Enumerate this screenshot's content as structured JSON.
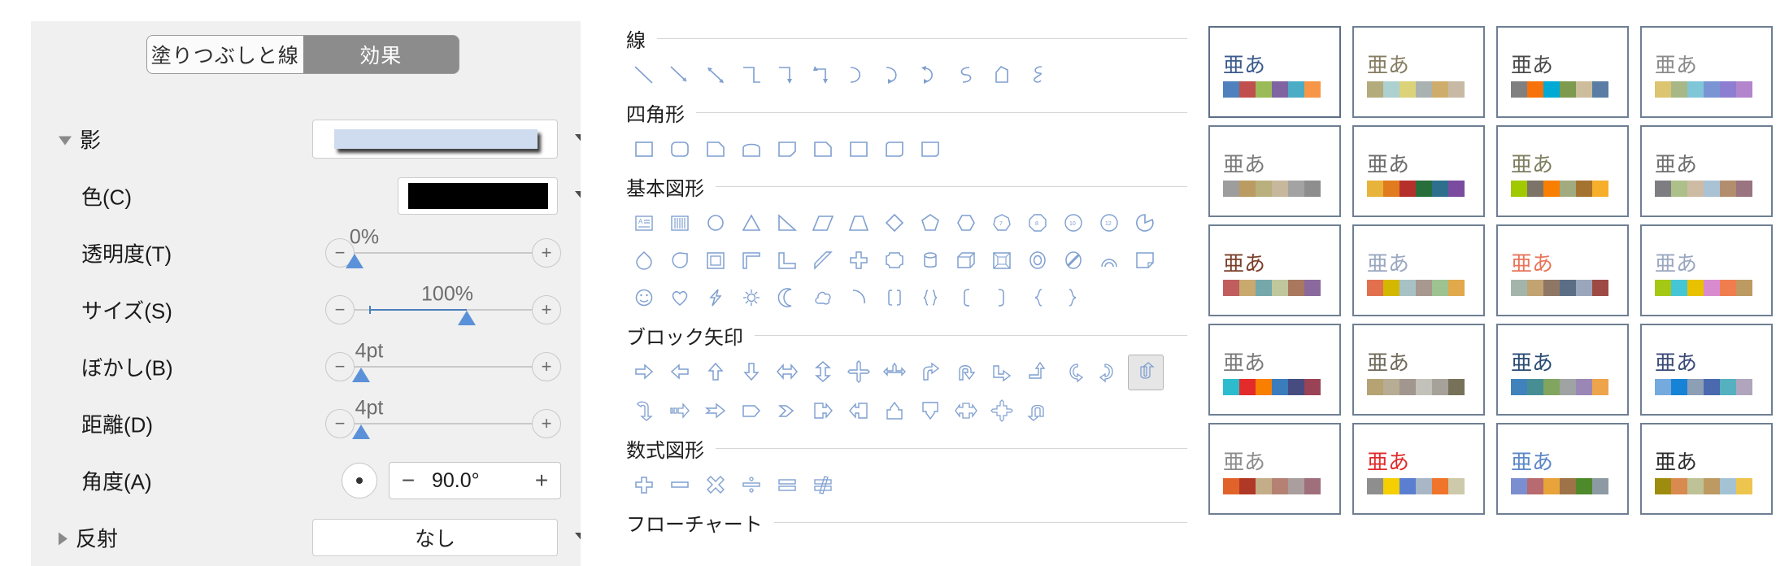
{
  "format_panel": {
    "tabs": [
      {
        "label": "塗りつぶしと線",
        "active": false
      },
      {
        "label": "効果",
        "active": true
      }
    ],
    "sections": [
      {
        "name": "shadow",
        "label": "影",
        "expanded": true,
        "disclosure": "triangle-down"
      },
      {
        "name": "reflection",
        "label": "反射",
        "expanded": false,
        "disclosure": "triangle-right"
      }
    ],
    "shadow_preset": {
      "label": "",
      "dropdown_arrow": "chevron-down-icon"
    },
    "rows": [
      {
        "id": "color",
        "label": "色(C)",
        "type": "color",
        "value": "#000000"
      },
      {
        "id": "transparency",
        "label": "透明度(T)",
        "type": "slider",
        "value": "0%",
        "percent": 0
      },
      {
        "id": "size",
        "label": "サイズ(S)",
        "type": "slider",
        "value": "100%",
        "percent": 45
      },
      {
        "id": "blur",
        "label": "ぼかし(B)",
        "type": "slider",
        "value": "4pt",
        "percent": 8
      },
      {
        "id": "distance",
        "label": "距離(D)",
        "type": "slider",
        "value": "4pt",
        "percent": 8
      },
      {
        "id": "angle",
        "label": "角度(A)",
        "type": "spinner",
        "value": "90.0°",
        "minus": "−",
        "plus": "+"
      }
    ],
    "reflection_value": "なし",
    "minus_label": "−",
    "plus_label": "+"
  },
  "shapes_panel": {
    "groups": [
      {
        "title": "線",
        "shapes": [
          "line",
          "line-arrow",
          "line-double-arrow",
          "elbow-connector",
          "elbow-arrow-connector",
          "elbow-double-arrow-connector",
          "curved-connector",
          "curved-arrow-connector",
          "curved-double-arrow-connector",
          "curve",
          "freeform",
          "scribble"
        ]
      },
      {
        "title": "四角形",
        "shapes": [
          "rectangle",
          "rounded-rectangle",
          "snip-single-corner-rectangle",
          "round-single-corner-top",
          "snip-diagonal-corner-rectangle",
          "snip-and-round-single-corner",
          "round-same-side-corner",
          "round-diagonal-corner",
          "snip-same-side-corner"
        ]
      },
      {
        "title": "基本図形",
        "shapes": [
          "text-box",
          "vertical-text-box",
          "oval",
          "isosceles-triangle",
          "right-triangle",
          "parallelogram",
          "trapezoid",
          "diamond",
          "pentagon",
          "hexagon",
          "heptagon",
          "octagon",
          "decagon",
          "dodecagon",
          "pie",
          "teardrop",
          "chord",
          "frame",
          "corner",
          "L-shape",
          "diagonal-stripe",
          "cross",
          "plaque",
          "can",
          "cube",
          "bevel",
          "donut",
          "no-symbol",
          "arc",
          "folded-corner",
          "smiley-face",
          "heart",
          "lightning-bolt",
          "sun",
          "moon",
          "cloud",
          "arc-open",
          "double-bracket",
          "double-brace",
          "left-bracket",
          "right-bracket",
          "left-brace",
          "right-brace"
        ]
      },
      {
        "title": "ブロック矢印",
        "shapes": [
          "right-arrow",
          "left-arrow",
          "up-arrow",
          "down-arrow",
          "left-right-arrow",
          "up-down-arrow",
          "quad-arrow",
          "left-right-up-arrow",
          "bent-arrow",
          "u-turn-arrow",
          "bent-up-arrow",
          "bent-up-arrow-2",
          "curved-left-arrow",
          "curved-right-arrow",
          "curved-up-arrow",
          "curved-down-arrow",
          "striped-right-arrow",
          "notched-right-arrow",
          "pentagon-arrow",
          "chevron-arrow",
          "right-arrow-callout",
          "left-arrow-callout",
          "up-arrow-callout",
          "down-arrow-callout",
          "left-right-arrow-callout",
          "quad-arrow-callout",
          "circular-arrow"
        ],
        "selected_index": 14
      },
      {
        "title": "数式図形",
        "shapes": [
          "plus-sign",
          "minus-sign",
          "multiply-sign",
          "division-sign",
          "equal-sign",
          "not-equal-sign"
        ]
      },
      {
        "title": "フローチャート",
        "shapes": []
      }
    ]
  },
  "themes_panel": {
    "sample_text": "亜あ",
    "cards": [
      {
        "text_color": "#3c5a8c",
        "colors": [
          "#4e81bd",
          "#c0504d",
          "#9bbb59",
          "#8064a2",
          "#4bacc6",
          "#f79646"
        ],
        "selected": true
      },
      {
        "text_color": "#857c61",
        "colors": [
          "#b3ab7c",
          "#add0d1",
          "#dbd27a",
          "#a9b2b1",
          "#ceac6b",
          "#c7b9a4"
        ]
      },
      {
        "text_color": "#4a4a4a",
        "colors": [
          "#808080",
          "#f7720b",
          "#00aad4",
          "#7d9a4f",
          "#cdbd9c",
          "#5b7da4"
        ]
      },
      {
        "text_color": "#8a8a8a",
        "colors": [
          "#ddc470",
          "#a8b786",
          "#80c6d9",
          "#7b95d4",
          "#8d7ed1",
          "#b385cc"
        ]
      },
      {
        "text_color": "#7a7a7a",
        "colors": [
          "#9d9d9d",
          "#ba9b62",
          "#b9b07d",
          "#c7b79c",
          "#a3a3a3",
          "#8e8e8e"
        ]
      },
      {
        "text_color": "#6b6b6b",
        "colors": [
          "#e8b33a",
          "#e07b1e",
          "#b5302b",
          "#276e3b",
          "#2f6f8e",
          "#7a4b9e"
        ]
      },
      {
        "text_color": "#7d7d5f",
        "colors": [
          "#a2c800",
          "#7c7468",
          "#f87f00",
          "#a2ab80",
          "#a57330",
          "#f6ae2b"
        ]
      },
      {
        "text_color": "#6e6e6e",
        "colors": [
          "#7e7e82",
          "#adc08a",
          "#cdbba3",
          "#a9c2d4",
          "#b28e6e",
          "#9a7480"
        ]
      },
      {
        "text_color": "#7b3f2a",
        "colors": [
          "#c05d5d",
          "#c9a96e",
          "#74a8ab",
          "#bfc79c",
          "#a9785f",
          "#8a6a9e"
        ]
      },
      {
        "text_color": "#9aa7c0",
        "colors": [
          "#e2704e",
          "#d4b800",
          "#a8c1c5",
          "#a79890",
          "#9ec391",
          "#e2a84c"
        ]
      },
      {
        "text_color": "#e8755a",
        "colors": [
          "#a3b5ab",
          "#c2a372",
          "#8e7764",
          "#5b6e86",
          "#9aa6bb",
          "#9e4a44"
        ]
      },
      {
        "text_color": "#9aa7c0",
        "colors": [
          "#a5c814",
          "#45c6d6",
          "#e8c100",
          "#d98bd0",
          "#ef7d4e",
          "#bd9a62"
        ]
      },
      {
        "text_color": "#7a7a7a",
        "colors": [
          "#2dbccd",
          "#e32b2b",
          "#f87f00",
          "#3b7cbd",
          "#464c80",
          "#9a4356"
        ]
      },
      {
        "text_color": "#6f6a5a",
        "colors": [
          "#b5a373",
          "#b7ac94",
          "#a2978e",
          "#c3c2ba",
          "#a6a299",
          "#77715a"
        ]
      },
      {
        "text_color": "#2b4c73",
        "colors": [
          "#4083bc",
          "#468e94",
          "#81a45f",
          "#a0a3a3",
          "#9b87b6",
          "#eda44a"
        ]
      },
      {
        "text_color": "#3b4a78",
        "colors": [
          "#74aadd",
          "#1683d6",
          "#8d9fb5",
          "#4b69ae",
          "#55b0bf",
          "#b0a5bd"
        ]
      },
      {
        "text_color": "#8c8c8c",
        "colors": [
          "#e2632a",
          "#b03826",
          "#c3ae87",
          "#b58173",
          "#aa9e9f",
          "#a06f7c"
        ]
      },
      {
        "text_color": "#e02b2b",
        "colors": [
          "#8e8e8e",
          "#f5cf00",
          "#5b7fd0",
          "#a8b6c6",
          "#f0742a",
          "#cdc9ab"
        ]
      },
      {
        "text_color": "#5b87c7",
        "colors": [
          "#7b8fd0",
          "#b76a6f",
          "#e8a33a",
          "#9e7348",
          "#4e8a2b",
          "#8e9aa3"
        ]
      },
      {
        "text_color": "#2e2e2e",
        "colors": [
          "#9e8c0e",
          "#d98a4e",
          "#bfc297",
          "#bd9a62",
          "#a3c2d4",
          "#edc44e"
        ]
      }
    ]
  }
}
